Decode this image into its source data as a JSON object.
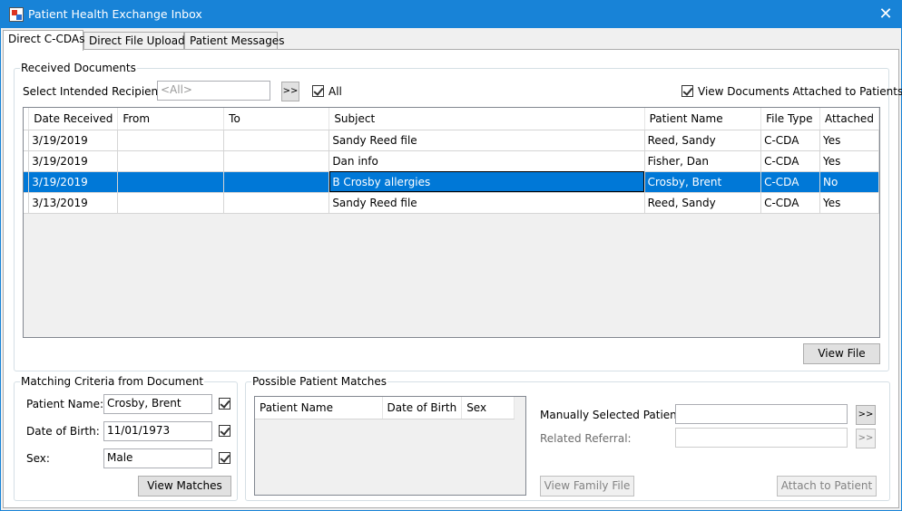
{
  "window": {
    "title": "Patient Health Exchange Inbox",
    "close_glyph": "✕"
  },
  "tabs": [
    {
      "label": "Direct C-CDAs",
      "active": true
    },
    {
      "label": "Direct File Uploads",
      "active": false
    },
    {
      "label": "Patient Messages",
      "active": false
    }
  ],
  "received": {
    "group_label": "Received Documents",
    "recipient_label": "Select Intended Recipient:",
    "recipient_placeholder": "<All>",
    "recipient_button": ">>",
    "all_label": "All",
    "all_checked": true,
    "view_attached_label": "View Documents Attached to Patients",
    "view_attached_checked": true,
    "columns": [
      "Date Received",
      "From",
      "To",
      "Subject",
      "Patient Name",
      "File Type",
      "Attached"
    ],
    "rows": [
      {
        "cells": [
          "3/19/2019",
          "",
          "",
          "Sandy Reed file",
          "Reed, Sandy",
          "C-CDA",
          "Yes"
        ],
        "selected": false
      },
      {
        "cells": [
          "3/19/2019",
          "",
          "",
          "Dan info",
          "Fisher, Dan",
          "C-CDA",
          "Yes"
        ],
        "selected": false
      },
      {
        "cells": [
          "3/19/2019",
          "",
          "",
          "B Crosby allergies",
          "Crosby, Brent",
          "C-CDA",
          "No"
        ],
        "selected": true
      },
      {
        "cells": [
          "3/13/2019",
          "",
          "",
          "Sandy Reed file",
          "Reed, Sandy",
          "C-CDA",
          "Yes"
        ],
        "selected": false
      }
    ],
    "view_file_button": "View File"
  },
  "matching": {
    "group_label": "Matching Criteria from Document",
    "patient_name_label": "Patient Name:",
    "patient_name_value": "Crosby, Brent",
    "dob_label": "Date of Birth:",
    "dob_value": "11/01/1973",
    "sex_label": "Sex:",
    "sex_value": "Male",
    "view_matches_button": "View Matches"
  },
  "possible": {
    "group_label": "Possible Patient Matches",
    "columns": [
      "Patient Name",
      "Date of Birth",
      "Sex"
    ],
    "manual_label": "Manually Selected Patient:",
    "manual_button": ">>",
    "referral_label": "Related Referral:",
    "referral_button": ">>",
    "view_family_button": "View Family File",
    "attach_button": "Attach to Patient"
  },
  "colors": {
    "titlebar": "#1883d7",
    "selection": "#0078d7"
  }
}
